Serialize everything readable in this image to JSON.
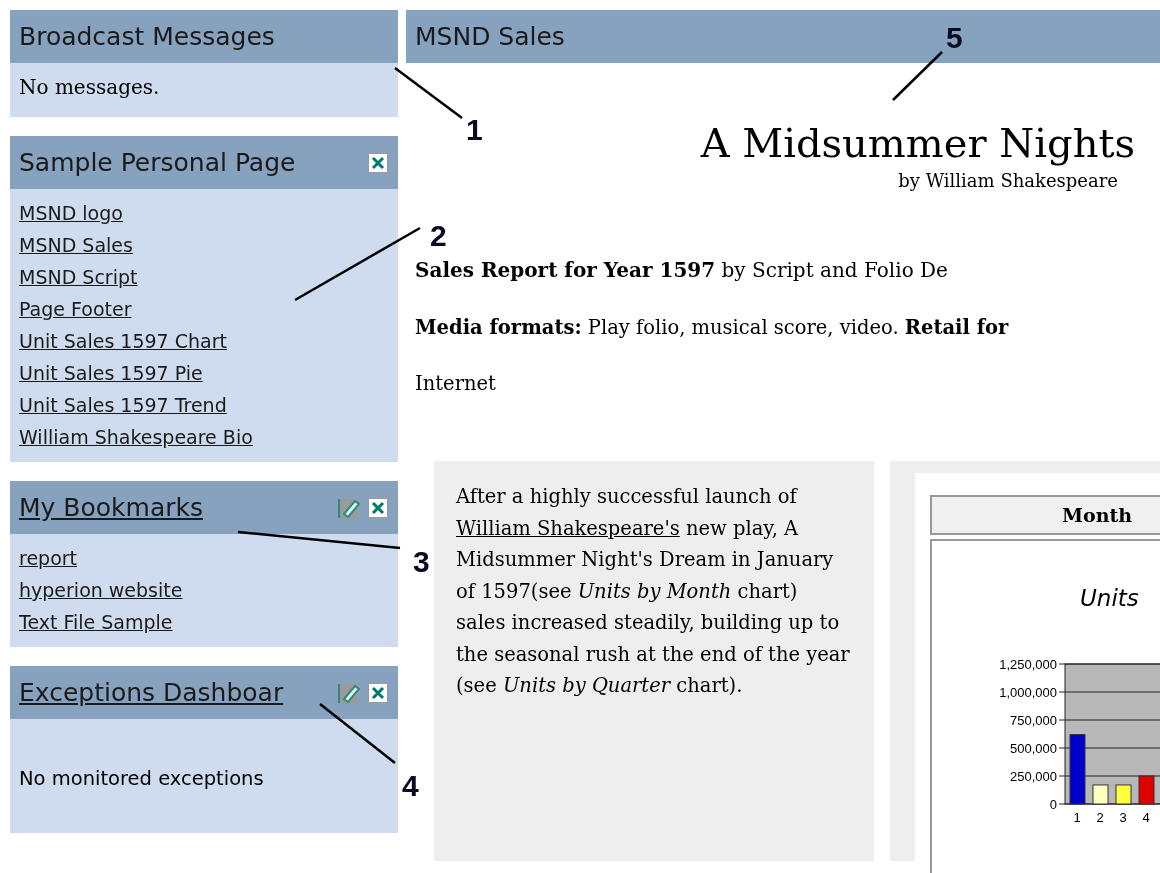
{
  "portlets": [
    {
      "title": "Broadcast Messages",
      "title_link": false,
      "closable": false,
      "editable": false,
      "kind": "message",
      "text": "No messages."
    },
    {
      "title": "Sample Personal Page",
      "title_link": false,
      "closable": true,
      "editable": false,
      "kind": "links",
      "links": [
        "MSND logo",
        "MSND Sales",
        "MSND Script",
        "Page Footer",
        "Unit Sales 1597 Chart",
        "Unit Sales 1597 Pie",
        "Unit Sales 1597 Trend",
        "William Shakespeare Bio"
      ]
    },
    {
      "title": "My Bookmarks",
      "title_link": true,
      "closable": true,
      "editable": true,
      "kind": "links",
      "links": [
        "report",
        "hyperion website",
        "Text File Sample"
      ]
    },
    {
      "title": "Exceptions Dashboar",
      "title_link": true,
      "closable": true,
      "editable": true,
      "kind": "status",
      "text": "No monitored exceptions"
    }
  ],
  "main": {
    "title": "MSND Sales",
    "heading": "A Midsummer Nights",
    "byline": "by William Shakespeare",
    "report_title": "**Sales Report for Year 1597** by Script and Folio De",
    "intro_lines": [
      "**Media formats:** Play folio, musical score, video. **Retail for**",
      "Internet"
    ],
    "story": {
      "before": "After a highly successful launch of ",
      "link": "William Shakespeare's",
      "after": " new play, A Midsummer Night's Dream in January of 1597(see *Units by Month* chart) sales increased steadily, building up to the seasonal rush at the end of the year (see *Units by Quarter* chart)."
    },
    "chart_panel": {
      "header": "Month",
      "chart_data": {
        "type": "bar",
        "title": "Units",
        "grid": true,
        "categories": [
          "1",
          "2",
          "3",
          "4"
        ],
        "values": [
          620000,
          170000,
          170000,
          250000
        ],
        "colors": [
          "#0000cc",
          "#ffffc0",
          "#ffff40",
          "#e00000"
        ],
        "ylim": [
          0,
          1250000
        ],
        "yticks": [
          {
            "value": 0,
            "label": "0"
          },
          {
            "value": 250000,
            "label": "250,000"
          },
          {
            "value": 500000,
            "label": "500,000"
          },
          {
            "value": 750000,
            "label": "750,000"
          },
          {
            "value": 1000000,
            "label": "1,000,000"
          },
          {
            "value": 1250000,
            "label": "1,250,000"
          }
        ]
      }
    }
  },
  "callouts": [
    {
      "label": "1"
    },
    {
      "label": "2"
    },
    {
      "label": "3"
    },
    {
      "label": "4"
    },
    {
      "label": "5"
    }
  ]
}
